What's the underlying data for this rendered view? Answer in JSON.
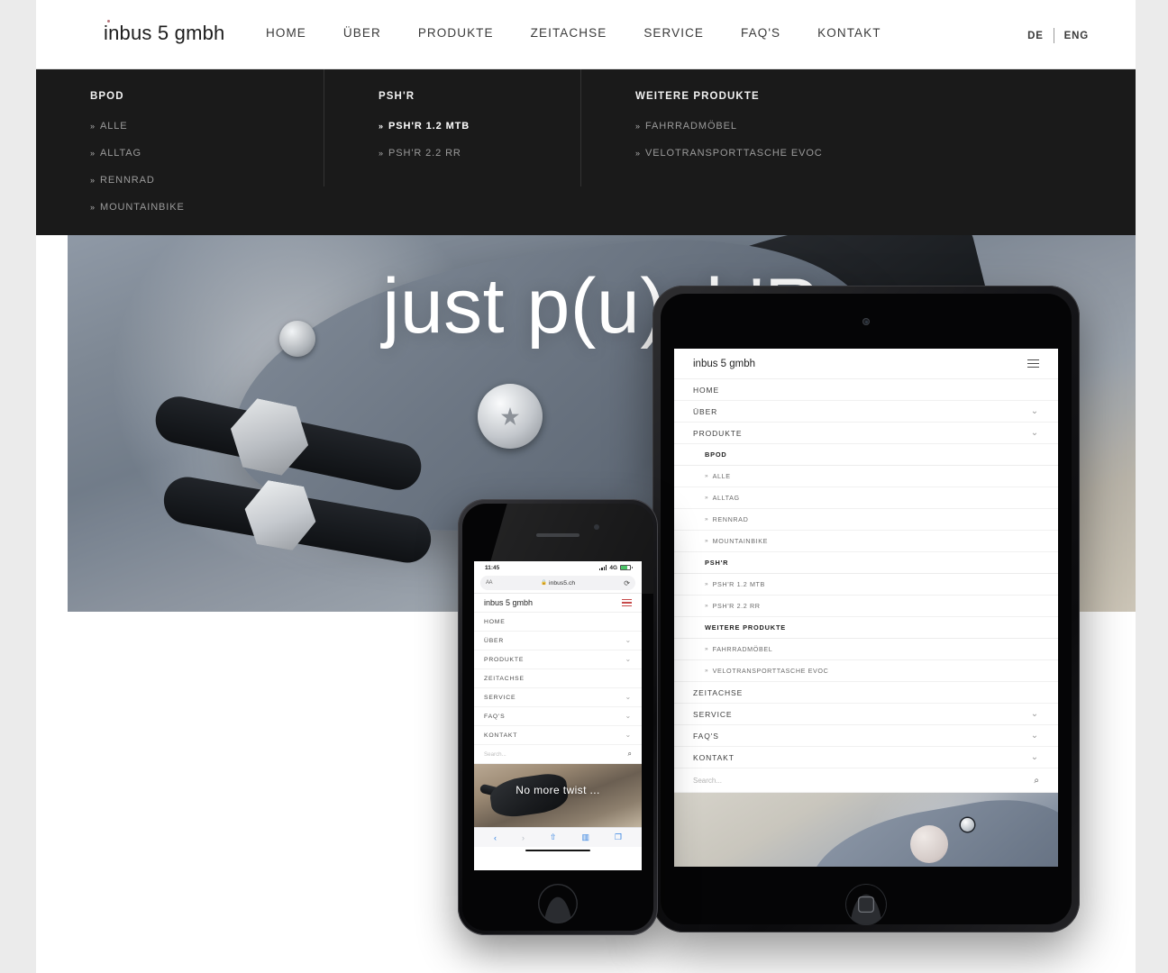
{
  "site": {
    "logo": "inbus 5 gmbh"
  },
  "nav": {
    "items": [
      {
        "label": "HOME"
      },
      {
        "label": "ÜBER"
      },
      {
        "label": "PRODUKTE"
      },
      {
        "label": "ZEITACHSE"
      },
      {
        "label": "SERVICE"
      },
      {
        "label": "FAQ'S"
      },
      {
        "label": "KONTAKT"
      }
    ],
    "lang": {
      "de": "DE",
      "en": "ENG"
    }
  },
  "megamenu": {
    "columns": [
      {
        "title": "BPOD",
        "items": [
          {
            "label": "ALLE",
            "active": false
          },
          {
            "label": "ALLTAG",
            "active": false
          },
          {
            "label": "RENNRAD",
            "active": false
          },
          {
            "label": "MOUNTAINBIKE",
            "active": false
          }
        ]
      },
      {
        "title": "PSH'R",
        "items": [
          {
            "label": "PSH'R 1.2 MTB",
            "active": true
          },
          {
            "label": "PSH'R 2.2 RR",
            "active": false
          }
        ]
      },
      {
        "title": "WEITERE PRODUKTE",
        "items": [
          {
            "label": "FAHRRADMÖBEL",
            "active": false
          },
          {
            "label": "VELOTRANSPORTTASCHE EVOC",
            "active": false
          }
        ]
      }
    ],
    "chevron_icon": "»"
  },
  "hero": {
    "caption": "just p(u)sh'R"
  },
  "tablet": {
    "logo": "inbus 5 gmbh",
    "menu": [
      {
        "label": "HOME",
        "type": "link"
      },
      {
        "label": "ÜBER",
        "type": "expandable"
      },
      {
        "label": "PRODUKTE",
        "type": "expandable"
      },
      {
        "label": "BPOD",
        "type": "group"
      },
      {
        "label": "ALLE",
        "type": "sub"
      },
      {
        "label": "ALLTAG",
        "type": "sub"
      },
      {
        "label": "RENNRAD",
        "type": "sub"
      },
      {
        "label": "MOUNTAINBIKE",
        "type": "sub"
      },
      {
        "label": "PSH'R",
        "type": "group"
      },
      {
        "label": "PSH'R 1.2 MTB",
        "type": "sub"
      },
      {
        "label": "PSH'R 2.2 RR",
        "type": "sub"
      },
      {
        "label": "WEITERE PRODUKTE",
        "type": "group"
      },
      {
        "label": "FAHRRADMÖBEL",
        "type": "sub"
      },
      {
        "label": "VELOTRANSPORTTASCHE EVOC",
        "type": "sub"
      },
      {
        "label": "ZEITACHSE",
        "type": "link"
      },
      {
        "label": "SERVICE",
        "type": "expandable"
      },
      {
        "label": "FAQ'S",
        "type": "expandable"
      },
      {
        "label": "KONTAKT",
        "type": "expandable"
      }
    ],
    "search_placeholder": "Search...",
    "chevron_down": "⌄",
    "sub_chevron": "»",
    "search_icon": "⌕"
  },
  "phone": {
    "status": {
      "time": "11:45",
      "network": "4G"
    },
    "url": "inbus5.ch",
    "url_aa_label": "AA",
    "lock_icon": "🔒",
    "reload_icon": "⟳",
    "logo": "inbus 5 gmbh",
    "menu": [
      {
        "label": "HOME",
        "type": "link"
      },
      {
        "label": "ÜBER",
        "type": "expandable"
      },
      {
        "label": "PRODUKTE",
        "type": "expandable"
      },
      {
        "label": "ZEITACHSE",
        "type": "link"
      },
      {
        "label": "SERVICE",
        "type": "expandable"
      },
      {
        "label": "FAQ'S",
        "type": "expandable"
      },
      {
        "label": "KONTAKT",
        "type": "expandable"
      }
    ],
    "search_placeholder": "Search...",
    "chevron_down": "⌄",
    "search_icon": "⌕",
    "hero_caption": "No more twist ...",
    "toolbar": {
      "back": "‹",
      "forward": "›",
      "share": "⇧",
      "bookmarks": "▥",
      "tabs": "❐"
    }
  },
  "colors": {
    "page_bg": "#ebebeb",
    "content_bg": "#ffffff",
    "megamenu_bg": "#1a1a1a",
    "accent_dot": "#b7747a",
    "phone_burger": "#c74a4a"
  }
}
